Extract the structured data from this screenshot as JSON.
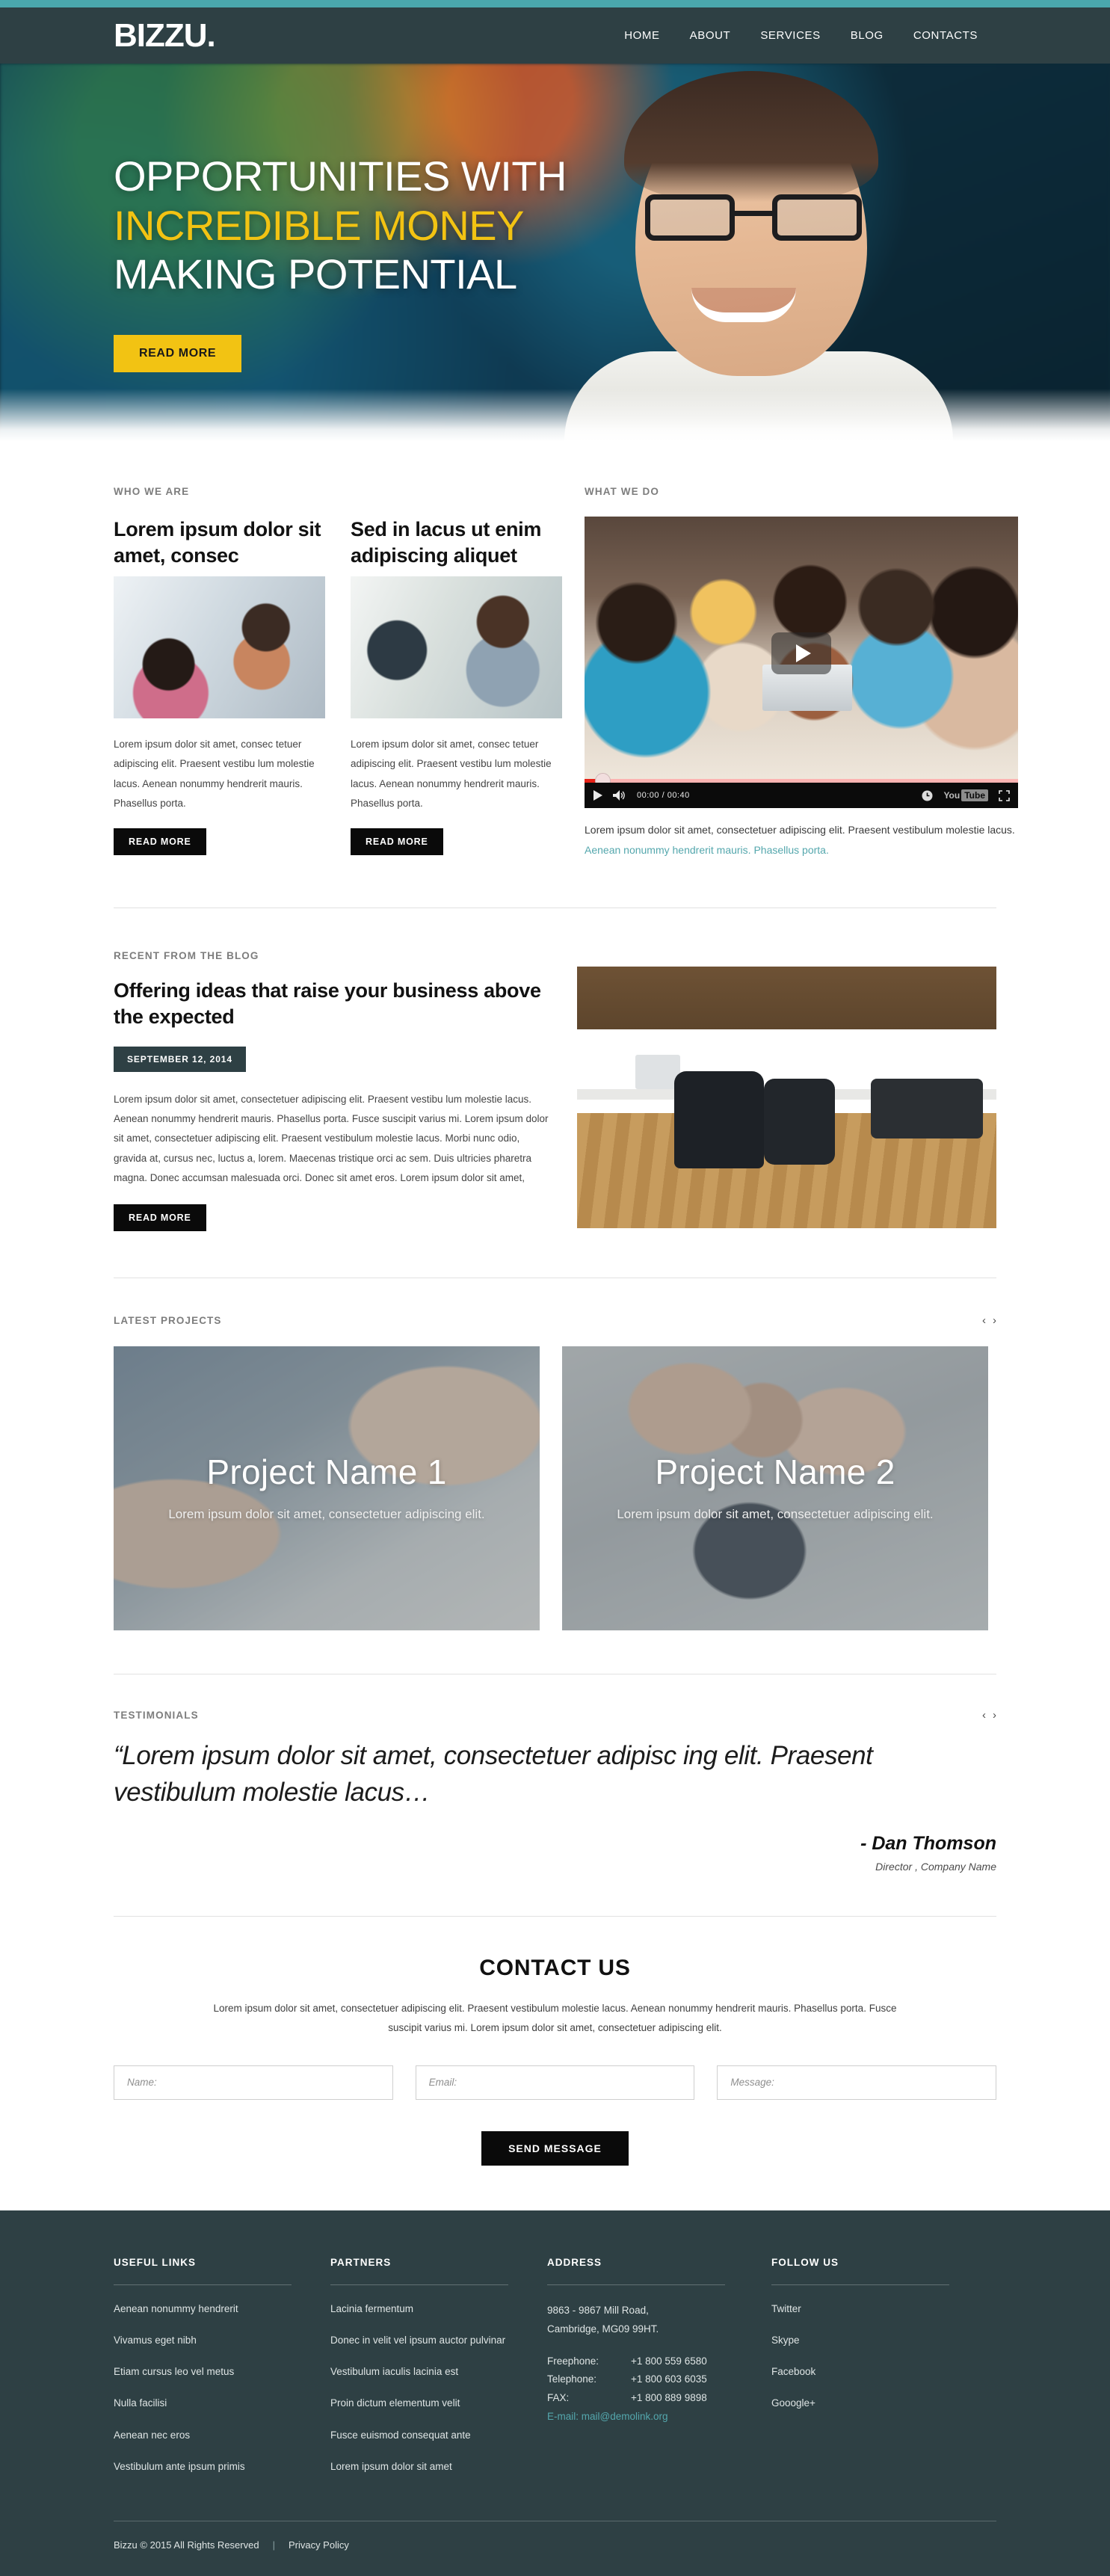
{
  "brand": {
    "logo": "BIZZU.",
    "accent_yellow": "#f2c313",
    "accent_teal": "#4aa7ad",
    "dark": "#2e4044"
  },
  "nav": {
    "items": [
      "HOME",
      "ABOUT",
      "SERVICES",
      "BLOG",
      "CONTACTS"
    ]
  },
  "hero": {
    "line1": "OPPORTUNITIES WITH",
    "line2": "INCREDIBLE MONEY",
    "line3": "MAKING POTENTIAL",
    "button": "READ MORE"
  },
  "about": {
    "eyebrow": "WHO WE ARE",
    "cards": [
      {
        "title": "Lorem ipsum dolor sit amet, consec",
        "text": "Lorem ipsum dolor sit amet, consec tetuer adipiscing elit. Praesent vestibu lum molestie lacus. Aenean nonummy hendrerit mauris. Phasellus porta.",
        "button": "READ MORE"
      },
      {
        "title": "Sed in lacus ut enim adipiscing aliquet",
        "text": "Lorem ipsum dolor sit amet, consec tetuer adipiscing elit. Praesent vestibu lum molestie lacus. Aenean nonummy hendrerit mauris. Phasellus porta.",
        "button": "READ MORE"
      }
    ]
  },
  "video": {
    "eyebrow": "WHAT WE DO",
    "time": "00:00 / 00:40",
    "youtube_you": "You",
    "youtube_tube": "Tube",
    "caption_plain": "Lorem ipsum dolor sit amet, consectetuer adipiscing elit. Praesent vestibulum molestie lacus. ",
    "caption_link": "Aenean nonummy hendrerit mauris. Phasellus porta."
  },
  "blog": {
    "eyebrow": "RECENT FROM THE BLOG",
    "title": "Offering ideas that raise your business above the expected",
    "date": "SEPTEMBER 12, 2014",
    "text": "Lorem ipsum dolor sit amet, consectetuer adipiscing elit. Praesent vestibu lum molestie lacus. Aenean nonummy hendrerit mauris. Phasellus porta. Fusce suscipit varius mi. Lorem ipsum dolor sit amet, consectetuer adipiscing elit. Praesent vestibulum molestie lacus. Morbi nunc odio, gravida at, cursus nec, luctus a, lorem. Maecenas tristique orci ac sem. Duis ultricies pharetra magna. Donec accumsan malesuada orci. Donec sit amet eros. Lorem ipsum dolor sit amet,",
    "button": "READ MORE"
  },
  "projects": {
    "eyebrow": "LATEST PROJECTS",
    "prev": "‹",
    "next": "›",
    "items": [
      {
        "title": "Project Name 1",
        "subtitle": "Lorem ipsum dolor sit amet, consectetuer adipiscing elit."
      },
      {
        "title": "Project Name 2",
        "subtitle": "Lorem ipsum dolor sit amet, consectetuer adipiscing elit."
      }
    ]
  },
  "testimonials": {
    "eyebrow": "TESTIMONIALS",
    "prev": "‹",
    "next": "›",
    "quote": "“Lorem ipsum dolor sit amet, consectetuer adipisc ing elit. Praesent vestibulum molestie lacus…",
    "author": "- Dan Thomson",
    "role": "Director , Company Name"
  },
  "contact": {
    "title": "CONTACT US",
    "description": "Lorem ipsum dolor sit amet, consectetuer adipiscing elit. Praesent vestibulum molestie lacus. Aenean nonummy hendrerit mauris. Phasellus porta. Fusce suscipit varius mi. Lorem ipsum dolor sit amet, consectetuer adipiscing elit.",
    "name_placeholder": "Name:",
    "email_placeholder": "Email:",
    "message_placeholder": "Message:",
    "send_label": "SEND MESSAGE"
  },
  "footer": {
    "useful_links": {
      "title": "USEFUL LINKS",
      "items": [
        "Aenean nonummy hendrerit",
        "Vivamus eget nibh",
        "Etiam cursus leo vel metus",
        "Nulla facilisi",
        "Aenean nec eros",
        "Vestibulum ante ipsum primis"
      ]
    },
    "partners": {
      "title": "PARTNERS",
      "items": [
        "Lacinia fermentum",
        "Donec in velit vel ipsum auctor pulvinar",
        "Vestibulum iaculis lacinia est",
        "Proin dictum elementum velit",
        "Fusce euismod consequat ante",
        "Lorem ipsum dolor sit amet"
      ]
    },
    "address": {
      "title": "ADDRESS",
      "line1": "9863 - 9867 Mill Road,",
      "line2": "Cambridge, MG09 99HT.",
      "freephone_label": "Freephone:",
      "freephone_value": "+1 800 559 6580",
      "telephone_label": "Telephone:",
      "telephone_value": "+1 800 603 6035",
      "fax_label": "FAX:",
      "fax_value": "+1 800 889 9898",
      "email_label": "E-mail:",
      "email_value": "mail@demolink.org"
    },
    "follow": {
      "title": "FOLLOW US",
      "items": [
        "Twitter",
        "Skype",
        "Facebook",
        "Gooogle+"
      ]
    },
    "copyright": "Bizzu © 2015 All Rights Reserved",
    "separator": "|",
    "privacy": "Privacy Policy"
  }
}
